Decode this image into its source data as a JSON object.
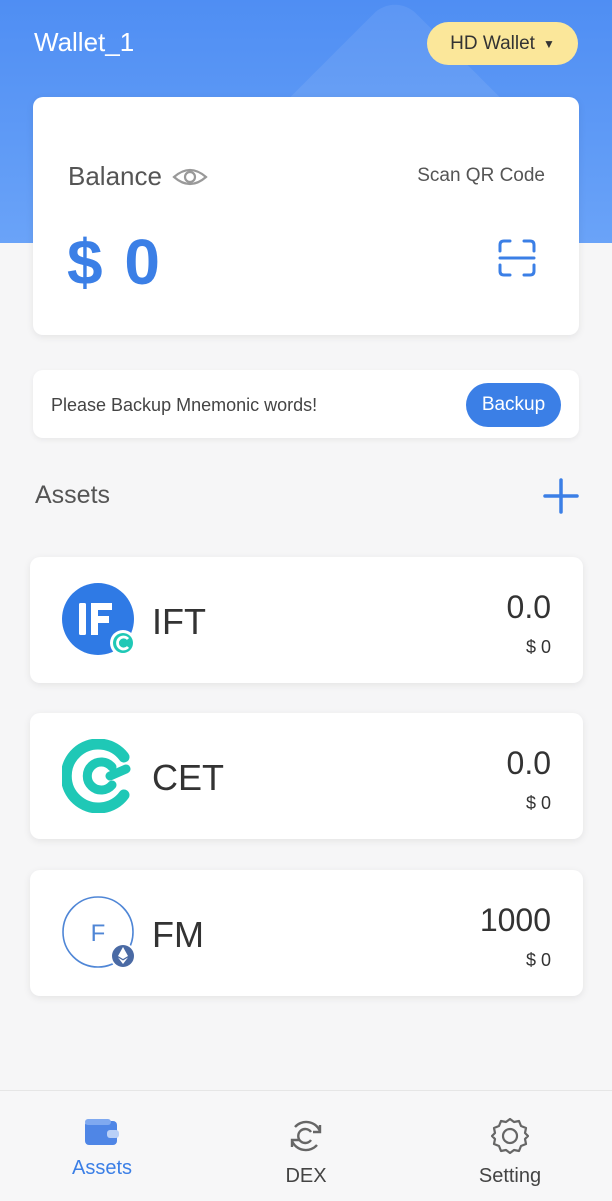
{
  "header": {
    "wallet_name": "Wallet_1",
    "wallet_type": "HD Wallet"
  },
  "balance": {
    "label": "Balance",
    "scan_label": "Scan QR Code",
    "value": "$ 0"
  },
  "backup": {
    "message": "Please Backup Mnemonic words!",
    "button_label": "Backup"
  },
  "assets": {
    "title": "Assets",
    "items": [
      {
        "symbol": "IFT",
        "amount": "0.0",
        "value": "$ 0"
      },
      {
        "symbol": "CET",
        "amount": "0.0",
        "value": "$ 0"
      },
      {
        "symbol": "FM",
        "amount": "1000",
        "value": "$ 0",
        "logo_letter": "F"
      }
    ]
  },
  "nav": {
    "items": [
      {
        "label": "Assets"
      },
      {
        "label": "DEX"
      },
      {
        "label": "Setting"
      }
    ]
  },
  "colors": {
    "accent": "#3b7fe6",
    "header_bg": "#5a98f5",
    "wallet_pill": "#fbe79a",
    "cet_teal": "#1fc8b6"
  },
  "icons": {
    "balance": "eye-icon",
    "scan": "scan-frame-icon",
    "add": "plus-icon",
    "nav": [
      "wallet-icon",
      "exchange-icon",
      "gear-icon"
    ]
  }
}
